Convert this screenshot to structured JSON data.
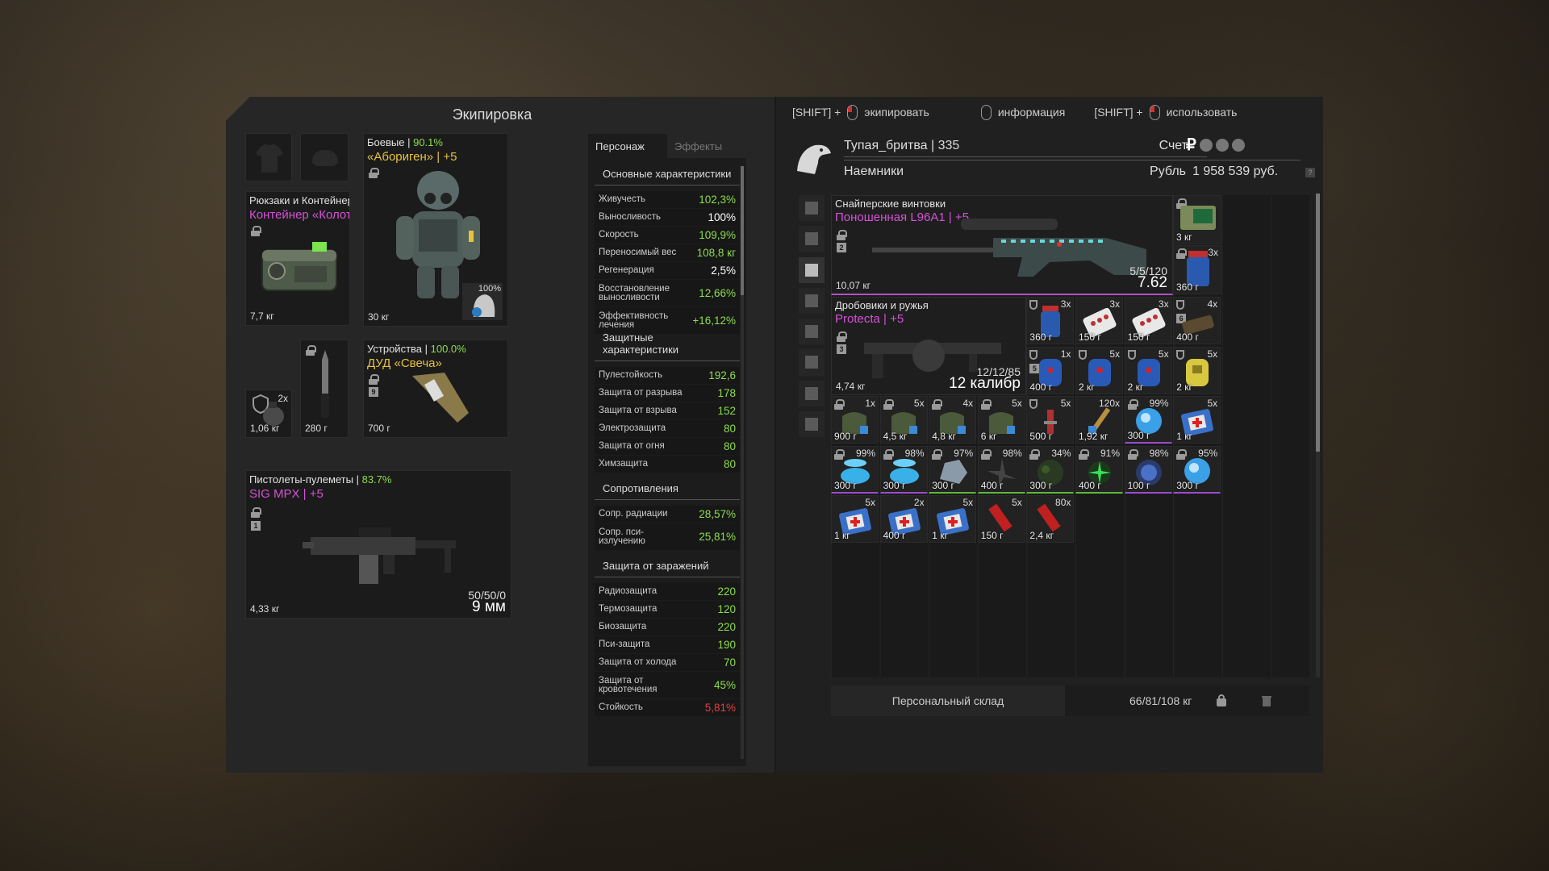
{
  "left": {
    "title": "Экипировка",
    "backpack": {
      "cat": "Рюкзаки и Контейнеры",
      "name": "Контейнер «Колотун»",
      "weight": "7,7 кг"
    },
    "armor": {
      "cat": "Боевые",
      "durability": "90.1%",
      "name": "«Абориген» | +5",
      "weight": "30 кг",
      "helmet_pct": "100%"
    },
    "grenade": {
      "count": "2x",
      "weight": "1,06 кг"
    },
    "knife": {
      "weight": "280 г"
    },
    "device": {
      "cat": "Устройства",
      "durability": "100.0%",
      "name": "ДУД «Свеча»",
      "weight": "700 г",
      "num": "9"
    },
    "smg": {
      "cat": "Пистолеты-пулеметы",
      "durability": "83.7%",
      "name": "SIG MPX | +5",
      "weight": "4,33 кг",
      "ammo": "50/50/0",
      "caliber": "9 мм",
      "num": "1"
    }
  },
  "stats": {
    "tabs": [
      "Персонаж",
      "Эффекты"
    ],
    "sections": [
      {
        "title": "Основные характеристики",
        "rows": [
          {
            "k": "Живучесть",
            "v": "102,3%",
            "c": "g"
          },
          {
            "k": "Выносливость",
            "v": "100%",
            "c": "w"
          },
          {
            "k": "Скорость",
            "v": "109,9%",
            "c": "g"
          },
          {
            "k": "Переносимый вес",
            "v": "108,8 кг",
            "c": "g"
          },
          {
            "k": "Регенерация",
            "v": "2,5%",
            "c": "w"
          },
          {
            "k": "Восстановление выносливости",
            "v": "12,66%",
            "c": "g"
          },
          {
            "k": "Эффективность лечения",
            "v": "+16,12%",
            "c": "g"
          }
        ]
      },
      {
        "title": "Защитные характеристики",
        "rows": [
          {
            "k": "Пулестойкость",
            "v": "192,6",
            "c": "g"
          },
          {
            "k": "Защита от разрыва",
            "v": "178",
            "c": "g"
          },
          {
            "k": "Защита от взрыва",
            "v": "152",
            "c": "g"
          },
          {
            "k": "Электрозащита",
            "v": "80",
            "c": "g"
          },
          {
            "k": "Защита от огня",
            "v": "80",
            "c": "g"
          },
          {
            "k": "Химзащита",
            "v": "80",
            "c": "g"
          }
        ]
      },
      {
        "title": "Сопротивления",
        "rows": [
          {
            "k": "Сопр. радиации",
            "v": "28,57%",
            "c": "g"
          },
          {
            "k": "Сопр. пси-излучению",
            "v": "25,81%",
            "c": "g"
          }
        ]
      },
      {
        "title": "Защита от заражений",
        "rows": [
          {
            "k": "Радиозащита",
            "v": "220",
            "c": "g"
          },
          {
            "k": "Термозащита",
            "v": "120",
            "c": "g"
          },
          {
            "k": "Биозащита",
            "v": "220",
            "c": "g"
          },
          {
            "k": "Пси-защита",
            "v": "190",
            "c": "g"
          },
          {
            "k": "Защита от холода",
            "v": "70",
            "c": "g"
          },
          {
            "k": "Защита от кровотечения",
            "v": "45%",
            "c": "g"
          },
          {
            "k": "Стойкость",
            "v": "5,81%",
            "c": "r"
          }
        ]
      }
    ]
  },
  "hints": {
    "shift1": "[SHIFT] +",
    "equip": "экипировать",
    "info": "информация",
    "shift2": "[SHIFT] +",
    "use": "использовать"
  },
  "player": {
    "name": "Тупая_бритва | 335",
    "faction": "Наемники",
    "account_label": "Счет",
    "currency": "Рубль",
    "money": "1 958 539 руб.",
    "rub": "₽"
  },
  "sniper": {
    "cat": "Снайперские винтовки",
    "name": "Поношенная L96A1 | +5",
    "weight": "10,07 кг",
    "ammo": "5/5/120",
    "caliber": "7.62",
    "num": "2"
  },
  "shotgun": {
    "cat": "Дробовики и ружья",
    "name": "Protecta | +5",
    "weight": "4,74 кг",
    "ammo": "12/12/85",
    "caliber": "12 калибр",
    "num": "3"
  },
  "side_items": [
    {
      "w": "3 кг",
      "c": ""
    },
    {
      "w": "360 г",
      "c": "3x"
    }
  ],
  "cells": [
    {
      "r": 0,
      "c": 4,
      "w": "360 г",
      "n": "3x",
      "t": "jar"
    },
    {
      "r": 0,
      "c": 5,
      "w": "150 г",
      "n": "3x",
      "t": "pills"
    },
    {
      "r": 0,
      "c": 6,
      "w": "150 г",
      "n": "3x",
      "t": "pills"
    },
    {
      "r": 0,
      "c": 7,
      "w": "400 г",
      "n": "4x",
      "t": "bar",
      "num": "6"
    },
    {
      "r": 1,
      "c": 4,
      "w": "400 г",
      "n": "1x",
      "t": "blue",
      "num": "5"
    },
    {
      "r": 1,
      "c": 5,
      "w": "2 кг",
      "n": "5x",
      "t": "blue"
    },
    {
      "r": 1,
      "c": 6,
      "w": "2 кг",
      "n": "5x",
      "t": "blue"
    },
    {
      "r": 1,
      "c": 7,
      "w": "2 кг",
      "n": "5x",
      "t": "yellow"
    },
    {
      "r": 2,
      "c": 0,
      "w": "900 г",
      "n": "1x",
      "t": "bag"
    },
    {
      "r": 2,
      "c": 1,
      "w": "4,5 кг",
      "n": "5x",
      "t": "bag"
    },
    {
      "r": 2,
      "c": 2,
      "w": "4,8 кг",
      "n": "4x",
      "t": "bag"
    },
    {
      "r": 2,
      "c": 3,
      "w": "6 кг",
      "n": "5x",
      "t": "bag"
    },
    {
      "r": 2,
      "c": 4,
      "w": "500 г",
      "n": "5x",
      "t": "spray"
    },
    {
      "r": 2,
      "c": 5,
      "w": "1,92 кг",
      "n": "120x",
      "t": "bullet"
    },
    {
      "r": 2,
      "c": 6,
      "w": "300 г",
      "n": "99%",
      "t": "orb",
      "g": "purple"
    },
    {
      "r": 2,
      "c": 7,
      "w": "1 кг",
      "n": "5x",
      "t": "medkit"
    },
    {
      "r": 3,
      "c": 0,
      "w": "300 г",
      "n": "99%",
      "t": "crystal",
      "g": "purple"
    },
    {
      "r": 3,
      "c": 1,
      "w": "300 г",
      "n": "98%",
      "t": "crystal",
      "g": "purple"
    },
    {
      "r": 3,
      "c": 2,
      "w": "300 г",
      "n": "97%",
      "t": "rock",
      "g": "green"
    },
    {
      "r": 3,
      "c": 3,
      "w": "400 г",
      "n": "98%",
      "t": "spike",
      "g": "green"
    },
    {
      "r": 3,
      "c": 4,
      "w": "300 г",
      "n": "34%",
      "t": "moss",
      "g": "green"
    },
    {
      "r": 3,
      "c": 5,
      "w": "400 г",
      "n": "91%",
      "t": "star",
      "g": "green"
    },
    {
      "r": 3,
      "c": 6,
      "w": "100 г",
      "n": "98%",
      "t": "sphere",
      "g": "purple"
    },
    {
      "r": 3,
      "c": 7,
      "w": "300 г",
      "n": "95%",
      "t": "orb",
      "g": "purple"
    },
    {
      "r": 4,
      "c": 0,
      "w": "1 кг",
      "n": "5x",
      "t": "medkit"
    },
    {
      "r": 4,
      "c": 1,
      "w": "400 г",
      "n": "2x",
      "t": "medkit"
    },
    {
      "r": 4,
      "c": 2,
      "w": "1 кг",
      "n": "5x",
      "t": "medkit"
    },
    {
      "r": 4,
      "c": 3,
      "w": "150 г",
      "n": "5x",
      "t": "shell"
    },
    {
      "r": 4,
      "c": 4,
      "w": "2,4 кг",
      "n": "80x",
      "t": "shell"
    }
  ],
  "footer": {
    "storage": "Персональный склад",
    "weight": "66/81/108 кг"
  }
}
